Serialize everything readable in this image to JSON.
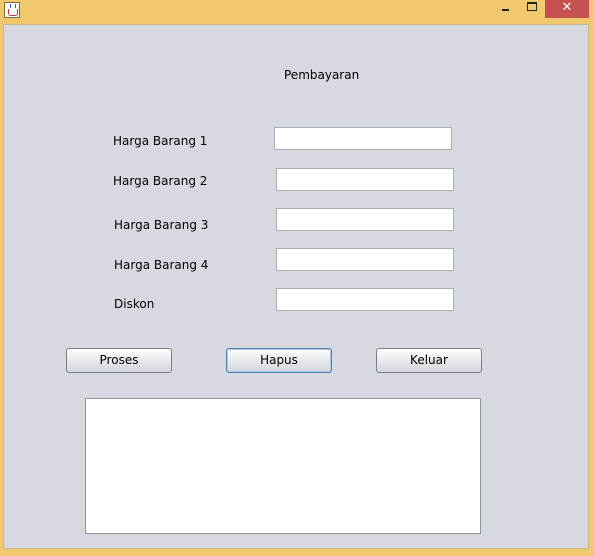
{
  "window": {
    "icon": "java-cup-icon",
    "close_glyph": "✕"
  },
  "header": {
    "title": "Pembayaran"
  },
  "form": {
    "fields": [
      {
        "label": "Harga Barang 1",
        "value": ""
      },
      {
        "label": "Harga Barang 2",
        "value": ""
      },
      {
        "label": "Harga Barang 3",
        "value": ""
      },
      {
        "label": "Harga Barang 4",
        "value": ""
      },
      {
        "label": "Diskon",
        "value": ""
      }
    ]
  },
  "buttons": {
    "proses": "Proses",
    "hapus": "Hapus",
    "keluar": "Keluar"
  },
  "output": {
    "text": ""
  },
  "colors": {
    "titlebar": "#f0c96e",
    "client_bg": "#d6d9df",
    "close_button": "#c75050"
  }
}
